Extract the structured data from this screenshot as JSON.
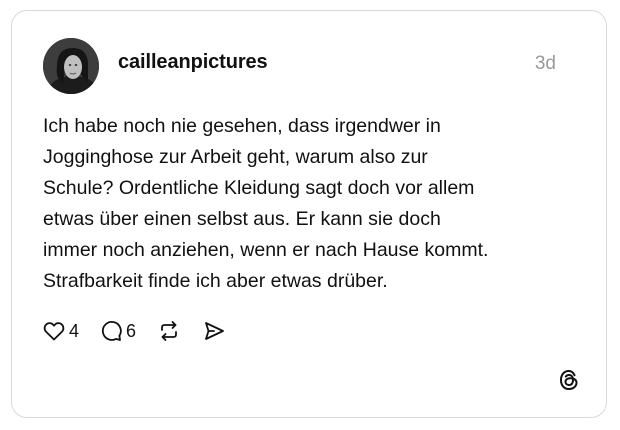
{
  "post": {
    "username": "cailleanpictures",
    "timestamp": "3d",
    "text_lines": [
      "Ich habe noch nie gesehen, dass irgendwer in",
      "Jogginghose zur Arbeit geht, warum also zur",
      "Schule? Ordentliche Kleidung sagt doch vor allem",
      "etwas über einen selbst aus. Er kann sie doch",
      "immer noch anziehen, wenn er nach Hause kommt.",
      "Strafbarkeit finde ich aber etwas drüber."
    ]
  },
  "actions": {
    "like_icon": "heart-icon",
    "like_count": "4",
    "reply_icon": "comment-icon",
    "reply_count": "6",
    "repost_icon": "repost-icon",
    "share_icon": "send-icon"
  },
  "branding": {
    "logo_icon": "threads-logo-icon"
  },
  "colors": {
    "text": "#111111",
    "muted": "#999999",
    "border": "#d9d9d9",
    "background": "#ffffff"
  }
}
